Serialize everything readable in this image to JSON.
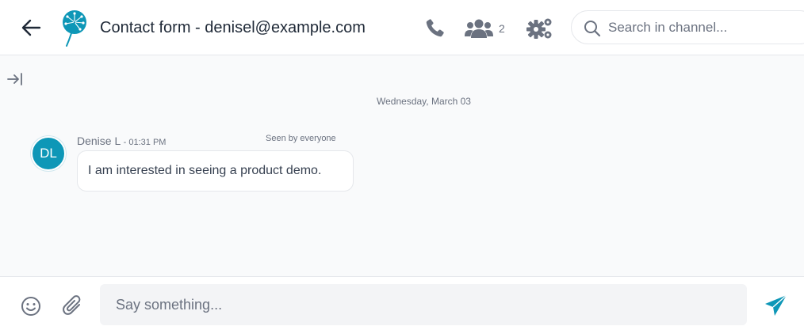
{
  "header": {
    "title": "Contact form - denisel@example.com",
    "members_count": "2",
    "search_placeholder": "Search in channel..."
  },
  "conversation": {
    "date_separator": "Wednesday, March 03",
    "messages": [
      {
        "avatar_initials": "DL",
        "sender": "Denise L",
        "time": "- 01:31 PM",
        "seen_status": "Seen by everyone",
        "text": "I am interested in seeing a product demo."
      }
    ]
  },
  "composer": {
    "placeholder": "Say something..."
  },
  "icons": {
    "back": "arrow-left-icon",
    "logo": "dandelion-logo",
    "call": "phone-icon",
    "members": "users-icon",
    "settings": "gears-icon",
    "search": "search-icon",
    "collapse": "collapse-sidebar-icon",
    "emoji": "emoji-icon",
    "attach": "paperclip-icon",
    "send": "send-icon"
  },
  "colors": {
    "accent": "#0e97b7",
    "icon_gray": "#6b7280",
    "main_background": "#f9fafb"
  }
}
